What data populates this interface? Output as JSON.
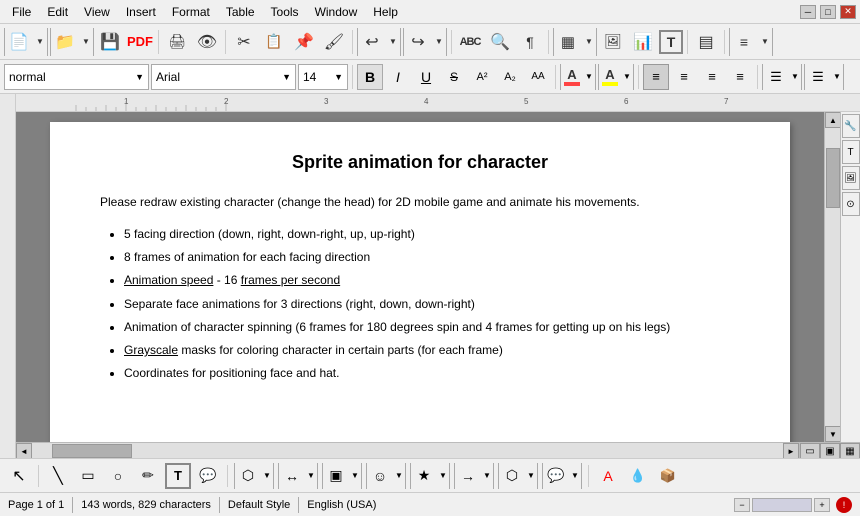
{
  "menu": {
    "items": [
      "File",
      "Edit",
      "View",
      "Insert",
      "Format",
      "Table",
      "Tools",
      "Window",
      "Help"
    ]
  },
  "toolbar1": {
    "buttons": [
      {
        "icon": "📄",
        "name": "new",
        "label": "New"
      },
      {
        "icon": "📁",
        "name": "open",
        "label": "Open"
      },
      {
        "icon": "💾",
        "name": "save",
        "label": "Save"
      },
      {
        "icon": "📕",
        "name": "pdf",
        "label": "PDF"
      },
      {
        "icon": "🖨",
        "name": "print",
        "label": "Print"
      },
      {
        "icon": "👁",
        "name": "preview",
        "label": "Preview"
      },
      {
        "icon": "✂",
        "name": "cut",
        "label": "Cut"
      },
      {
        "icon": "📋",
        "name": "copy",
        "label": "Copy"
      },
      {
        "icon": "📌",
        "name": "paste",
        "label": "Paste"
      },
      {
        "icon": "🖌",
        "name": "format-paint",
        "label": "Format Paint"
      },
      {
        "icon": "↩",
        "name": "undo",
        "label": "Undo"
      },
      {
        "icon": "↪",
        "name": "redo",
        "label": "Redo"
      },
      {
        "icon": "ABC",
        "name": "spellcheck",
        "label": "Spellcheck"
      },
      {
        "icon": "🔍",
        "name": "find",
        "label": "Find"
      },
      {
        "icon": "¶",
        "name": "nonprinting",
        "label": "Non-printing chars"
      },
      {
        "icon": "▦",
        "name": "table-insert",
        "label": "Insert Table"
      },
      {
        "icon": "🖼",
        "name": "insert-image",
        "label": "Insert Image"
      },
      {
        "icon": "📊",
        "name": "insert-chart",
        "label": "Insert Chart"
      },
      {
        "icon": "T",
        "name": "insert-text",
        "label": "Insert Text Box"
      },
      {
        "icon": "▤",
        "name": "frame",
        "label": "Frame"
      },
      {
        "icon": "≡",
        "name": "navigator",
        "label": "Navigator"
      }
    ]
  },
  "toolbar2": {
    "style": "normal",
    "font": "Arial",
    "size": "14",
    "buttons": {
      "bold": "B",
      "italic": "I",
      "underline": "U",
      "strikethrough": "S",
      "superscript": "x²",
      "subscript": "x₂",
      "uppercase": "AA",
      "color_label": "A",
      "highlight_label": "A"
    },
    "align_buttons": [
      "≡",
      "≡",
      "≡",
      "≡"
    ],
    "list_buttons": [
      "☰",
      "☰"
    ]
  },
  "document": {
    "title": "Sprite animation for character",
    "paragraph": "Please redraw existing character (change the head) for 2D mobile game and animate his movements.",
    "bullet_items": [
      "5 facing direction (down, right, down-right, up, up-right)",
      "8 frames of animation for each facing direction",
      "Animation speed - 16 frames per second",
      "Separate face animations for 3 directions (right, down, down-right)",
      "Animation of character spinning (6 frames for 180 degrees spin and 4 frames for getting up on his legs)",
      "Grayscale masks for coloring character in certain parts (for each frame)",
      "Coordinates for positioning face and hat."
    ]
  },
  "status_bar": {
    "page": "Page 1 of 1",
    "words": "143 words, 829 characters",
    "style": "Default Style",
    "language": "English (USA)"
  },
  "drawing_tools": [
    {
      "icon": "↖",
      "name": "select"
    },
    {
      "icon": "/",
      "name": "line"
    },
    {
      "icon": "▭",
      "name": "rectangle"
    },
    {
      "icon": "◯",
      "name": "ellipse"
    },
    {
      "icon": "✏",
      "name": "freeform"
    },
    {
      "icon": "T",
      "name": "text"
    },
    {
      "icon": "💬",
      "name": "callout"
    },
    {
      "icon": "⬡",
      "name": "polygon"
    },
    {
      "icon": "↔",
      "name": "connector"
    },
    {
      "icon": "▣",
      "name": "basic-shapes"
    },
    {
      "icon": "…",
      "name": "more-shapes"
    },
    {
      "icon": "☺",
      "name": "symbol"
    },
    {
      "icon": "★",
      "name": "stars"
    },
    {
      "icon": "→",
      "name": "arrows"
    },
    {
      "icon": "↗",
      "name": "flowchart"
    },
    {
      "icon": "⬡",
      "name": "callouts"
    },
    {
      "icon": "🔴",
      "name": "font-color"
    },
    {
      "icon": "💧",
      "name": "shadow"
    },
    {
      "icon": "📦",
      "name": "3d"
    }
  ]
}
